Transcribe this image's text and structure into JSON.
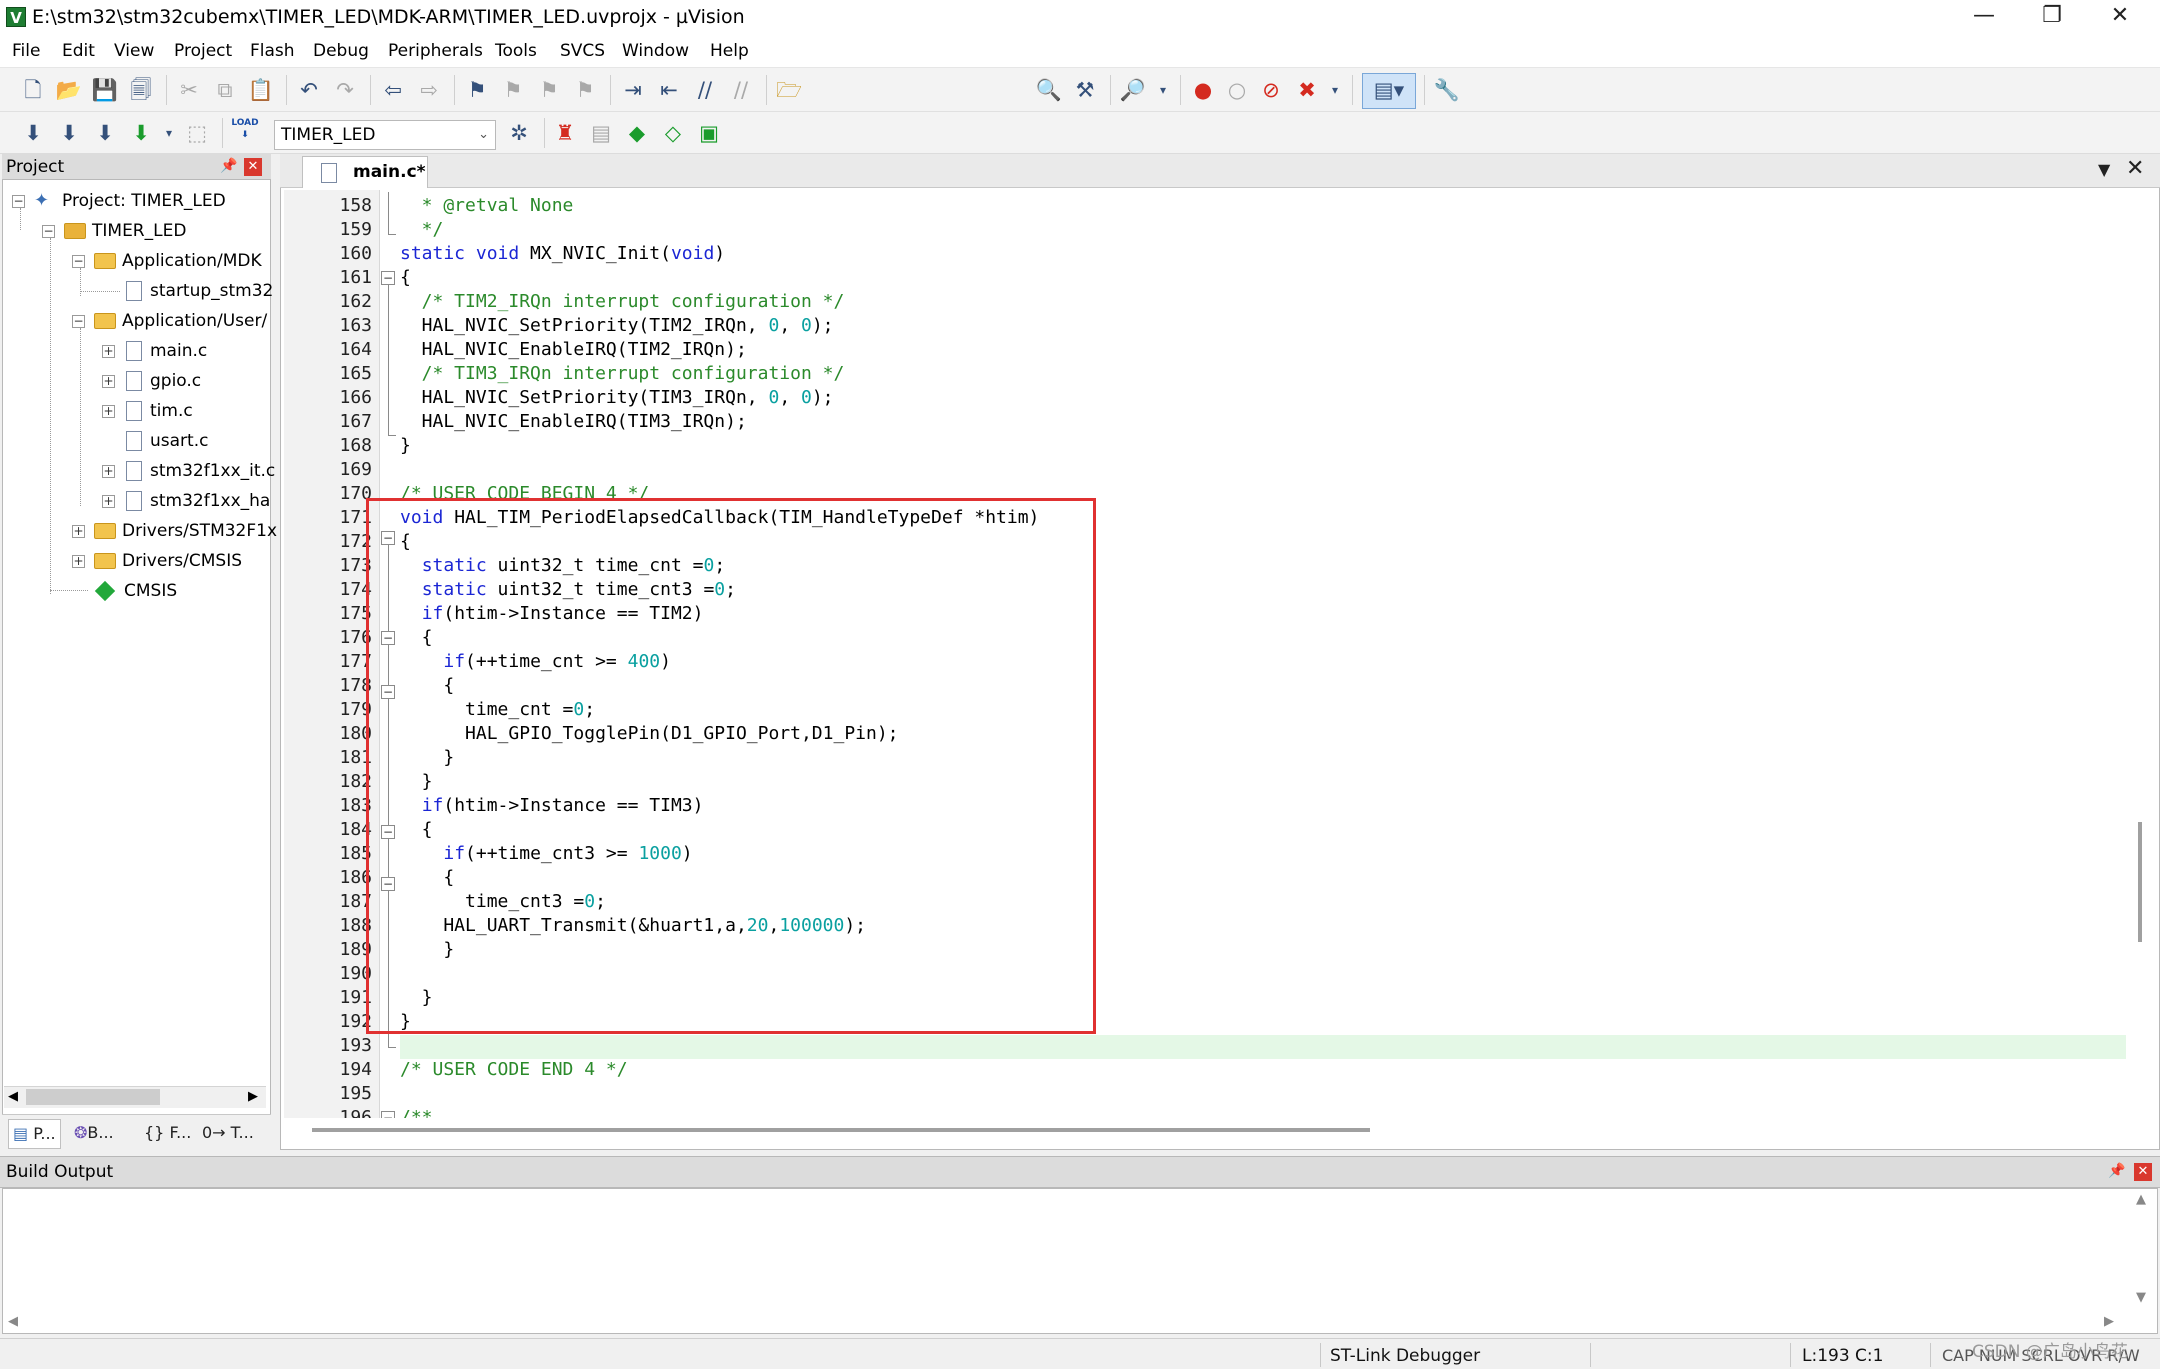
{
  "window": {
    "title": "E:\\stm32\\stm32cubemx\\TIMER_LED\\MDK-ARM\\TIMER_LED.uvprojx - µVision",
    "minimize": "—",
    "restore": "❐",
    "close": "✕"
  },
  "menu": [
    "File",
    "Edit",
    "View",
    "Project",
    "Flash",
    "Debug",
    "Peripherals",
    "Tools",
    "SVCS",
    "Window",
    "Help"
  ],
  "toolbar": {
    "target": "TIMER_LED",
    "load_label": "LOAD",
    "icons": {
      "new": "new-file-icon",
      "open": "open-folder-icon",
      "save": "save-icon",
      "save_all": "save-all-icon",
      "cut": "cut-icon",
      "copy": "copy-icon",
      "paste": "paste-icon",
      "undo": "undo-icon",
      "redo": "redo-icon",
      "nav_back": "navigate-back-icon",
      "nav_forward": "navigate-forward-icon",
      "bookmark": "bookmark-icon",
      "debug_start": "debug-start-icon",
      "breakpoint": "breakpoint-icon"
    }
  },
  "project_panel": {
    "title": "Project",
    "tree": {
      "root": "Project: TIMER_LED",
      "target": "TIMER_LED",
      "groups": [
        {
          "name": "Application/MDK",
          "files": [
            "startup_stm32"
          ]
        },
        {
          "name": "Application/User/",
          "files": [
            "main.c",
            "gpio.c",
            "tim.c",
            "usart.c",
            "stm32f1xx_it.c",
            "stm32f1xx_ha"
          ]
        },
        {
          "name": "Drivers/STM32F1x",
          "files": []
        },
        {
          "name": "Drivers/CMSIS",
          "files": []
        }
      ],
      "cmsis": "CMSIS"
    },
    "tabs": [
      "P...",
      "B...",
      "{} F...",
      "0→ T..."
    ]
  },
  "editor": {
    "tab": "main.c*",
    "lines": [
      {
        "n": "158",
        "segments": [
          {
            "t": "  * @retval None",
            "c": "cm"
          }
        ]
      },
      {
        "n": "159",
        "segments": [
          {
            "t": "  */",
            "c": "cm"
          }
        ]
      },
      {
        "n": "160",
        "segments": [
          {
            "t": "static void",
            "c": "kw"
          },
          {
            "t": " MX_NVIC_Init(",
            "c": ""
          },
          {
            "t": "void",
            "c": "kw"
          },
          {
            "t": ")",
            "c": ""
          }
        ]
      },
      {
        "n": "161",
        "segments": [
          {
            "t": "{",
            "c": ""
          }
        ]
      },
      {
        "n": "162",
        "segments": [
          {
            "t": "  /* TIM2_IRQn interrupt configuration */",
            "c": "cm"
          }
        ]
      },
      {
        "n": "163",
        "segments": [
          {
            "t": "  HAL_NVIC_SetPriority(TIM2_IRQn, ",
            "c": ""
          },
          {
            "t": "0",
            "c": "nm"
          },
          {
            "t": ", ",
            "c": ""
          },
          {
            "t": "0",
            "c": "nm"
          },
          {
            "t": ");",
            "c": ""
          }
        ]
      },
      {
        "n": "164",
        "segments": [
          {
            "t": "  HAL_NVIC_EnableIRQ(TIM2_IRQn);",
            "c": ""
          }
        ]
      },
      {
        "n": "165",
        "segments": [
          {
            "t": "  /* TIM3_IRQn interrupt configuration */",
            "c": "cm"
          }
        ]
      },
      {
        "n": "166",
        "segments": [
          {
            "t": "  HAL_NVIC_SetPriority(TIM3_IRQn, ",
            "c": ""
          },
          {
            "t": "0",
            "c": "nm"
          },
          {
            "t": ", ",
            "c": ""
          },
          {
            "t": "0",
            "c": "nm"
          },
          {
            "t": ");",
            "c": ""
          }
        ]
      },
      {
        "n": "167",
        "segments": [
          {
            "t": "  HAL_NVIC_EnableIRQ(TIM3_IRQn);",
            "c": ""
          }
        ]
      },
      {
        "n": "168",
        "segments": [
          {
            "t": "}",
            "c": ""
          }
        ]
      },
      {
        "n": "169",
        "segments": []
      },
      {
        "n": "170",
        "segments": [
          {
            "t": "/* USER CODE BEGIN 4 */",
            "c": "cm"
          }
        ]
      },
      {
        "n": "171",
        "segments": [
          {
            "t": "void",
            "c": "kw"
          },
          {
            "t": " HAL_TIM_PeriodElapsedCallback(TIM_HandleTypeDef *htim)",
            "c": ""
          }
        ]
      },
      {
        "n": "172",
        "segments": [
          {
            "t": "{",
            "c": ""
          }
        ]
      },
      {
        "n": "173",
        "segments": [
          {
            "t": "  ",
            "c": ""
          },
          {
            "t": "static",
            "c": "kw"
          },
          {
            "t": " uint32_t time_cnt =",
            "c": ""
          },
          {
            "t": "0",
            "c": "nm"
          },
          {
            "t": ";",
            "c": ""
          }
        ]
      },
      {
        "n": "174",
        "segments": [
          {
            "t": "  ",
            "c": ""
          },
          {
            "t": "static",
            "c": "kw"
          },
          {
            "t": " uint32_t time_cnt3 =",
            "c": ""
          },
          {
            "t": "0",
            "c": "nm"
          },
          {
            "t": ";",
            "c": ""
          }
        ]
      },
      {
        "n": "175",
        "segments": [
          {
            "t": "  ",
            "c": ""
          },
          {
            "t": "if",
            "c": "kw"
          },
          {
            "t": "(htim->Instance == TIM2)",
            "c": ""
          }
        ]
      },
      {
        "n": "176",
        "segments": [
          {
            "t": "  {",
            "c": ""
          }
        ]
      },
      {
        "n": "177",
        "segments": [
          {
            "t": "    ",
            "c": ""
          },
          {
            "t": "if",
            "c": "kw"
          },
          {
            "t": "(++time_cnt >= ",
            "c": ""
          },
          {
            "t": "400",
            "c": "nm"
          },
          {
            "t": ")",
            "c": ""
          }
        ]
      },
      {
        "n": "178",
        "segments": [
          {
            "t": "    {",
            "c": ""
          }
        ]
      },
      {
        "n": "179",
        "segments": [
          {
            "t": "      time_cnt =",
            "c": ""
          },
          {
            "t": "0",
            "c": "nm"
          },
          {
            "t": ";",
            "c": ""
          }
        ]
      },
      {
        "n": "180",
        "segments": [
          {
            "t": "      HAL_GPIO_TogglePin(D1_GPIO_Port,D1_Pin);",
            "c": ""
          }
        ]
      },
      {
        "n": "181",
        "segments": [
          {
            "t": "    }",
            "c": ""
          }
        ]
      },
      {
        "n": "182",
        "segments": [
          {
            "t": "  }",
            "c": ""
          }
        ]
      },
      {
        "n": "183",
        "segments": [
          {
            "t": "  ",
            "c": ""
          },
          {
            "t": "if",
            "c": "kw"
          },
          {
            "t": "(htim->Instance == TIM3)",
            "c": ""
          }
        ]
      },
      {
        "n": "184",
        "segments": [
          {
            "t": "  {",
            "c": ""
          }
        ]
      },
      {
        "n": "185",
        "segments": [
          {
            "t": "    ",
            "c": ""
          },
          {
            "t": "if",
            "c": "kw"
          },
          {
            "t": "(++time_cnt3 >= ",
            "c": ""
          },
          {
            "t": "1000",
            "c": "nm"
          },
          {
            "t": ")",
            "c": ""
          }
        ]
      },
      {
        "n": "186",
        "segments": [
          {
            "t": "    {",
            "c": ""
          }
        ]
      },
      {
        "n": "187",
        "segments": [
          {
            "t": "      time_cnt3 =",
            "c": ""
          },
          {
            "t": "0",
            "c": "nm"
          },
          {
            "t": ";",
            "c": ""
          }
        ]
      },
      {
        "n": "188",
        "segments": [
          {
            "t": "    HAL_UART_Transmit(&huart1,a,",
            "c": ""
          },
          {
            "t": "20",
            "c": "nm"
          },
          {
            "t": ",",
            "c": ""
          },
          {
            "t": "100000",
            "c": "nm"
          },
          {
            "t": ");",
            "c": ""
          }
        ]
      },
      {
        "n": "189",
        "segments": [
          {
            "t": "    }",
            "c": ""
          }
        ]
      },
      {
        "n": "190",
        "segments": []
      },
      {
        "n": "191",
        "segments": [
          {
            "t": "  }",
            "c": ""
          }
        ]
      },
      {
        "n": "192",
        "segments": [
          {
            "t": "}",
            "c": ""
          }
        ]
      },
      {
        "n": "193",
        "segments": []
      },
      {
        "n": "194",
        "segments": [
          {
            "t": "/* USER CODE END 4 */",
            "c": "cm"
          }
        ]
      },
      {
        "n": "195",
        "segments": []
      },
      {
        "n": "196",
        "segments": [
          {
            "t": "/**",
            "c": "cm"
          }
        ]
      }
    ]
  },
  "build_output": {
    "title": "Build Output"
  },
  "status": {
    "debugger": "ST-Link Debugger",
    "cursor": "L:193 C:1",
    "flags": "CAP  NUM  SCRL  OVR  R/W",
    "watermark": "CSDN @广岛小鸟花"
  }
}
